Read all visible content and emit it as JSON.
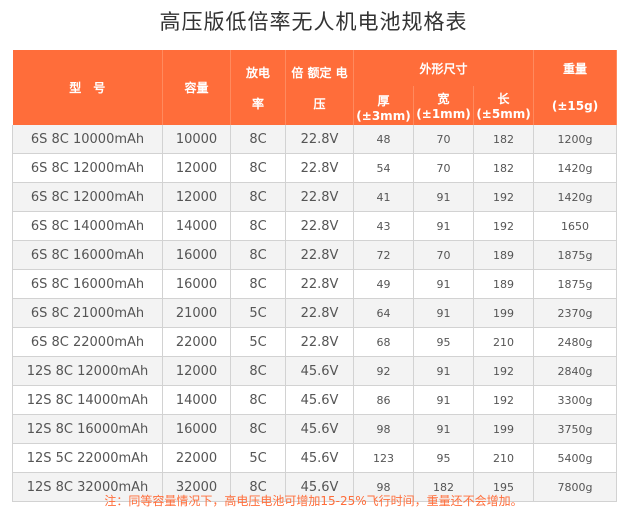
{
  "title": "高压版低倍率无人机电池规格表",
  "header": {
    "model": "型　号",
    "capacity": "容量",
    "rate_top": "放电",
    "rate_bottom": "率",
    "voltage_top": "倍 额定 电",
    "voltage_bottom": "压",
    "dimensions": "外形尺寸",
    "thickness": "厚(±3mm)",
    "width": "宽",
    "width_tol": "(±1mm)",
    "length": "长",
    "length_tol": "(±5mm)",
    "weight": "重量",
    "weight_tol": "(±15g)"
  },
  "rows": [
    [
      "6S 8C 10000mAh",
      "10000",
      "8C",
      "22.8V",
      "48",
      "70",
      "182",
      "1200g"
    ],
    [
      "6S 8C 12000mAh",
      "12000",
      "8C",
      "22.8V",
      "54",
      "70",
      "182",
      "1420g"
    ],
    [
      "6S 8C 12000mAh",
      "12000",
      "8C",
      "22.8V",
      "41",
      "91",
      "192",
      "1420g"
    ],
    [
      "6S 8C 14000mAh",
      "14000",
      "8C",
      "22.8V",
      "43",
      "91",
      "192",
      "1650"
    ],
    [
      "6S 8C 16000mAh",
      "16000",
      "8C",
      "22.8V",
      "72",
      "70",
      "189",
      "1875g"
    ],
    [
      "6S 8C 16000mAh",
      "16000",
      "8C",
      "22.8V",
      "49",
      "91",
      "189",
      "1875g"
    ],
    [
      "6S 8C 21000mAh",
      "21000",
      "5C",
      "22.8V",
      "64",
      "91",
      "199",
      "2370g"
    ],
    [
      "6S 8C 22000mAh",
      "22000",
      "5C",
      "22.8V",
      "68",
      "95",
      "210",
      "2480g"
    ],
    [
      "12S 8C 12000mAh",
      "12000",
      "8C",
      "45.6V",
      "92",
      "91",
      "192",
      "2840g"
    ],
    [
      "12S 8C 14000mAh",
      "14000",
      "8C",
      "45.6V",
      "86",
      "91",
      "192",
      "3300g"
    ],
    [
      "12S 8C 16000mAh",
      "16000",
      "8C",
      "45.6V",
      "98",
      "91",
      "199",
      "3750g"
    ],
    [
      "12S 5C 22000mAh",
      "22000",
      "5C",
      "45.6V",
      "123",
      "95",
      "210",
      "5400g"
    ],
    [
      "12S 8C 32000mAh",
      "32000",
      "8C",
      "45.6V",
      "98",
      "182",
      "195",
      "7800g"
    ]
  ],
  "note": "注：同等容量情况下，高电压电池可增加15-25%飞行时间，重量还不会增加。",
  "colors": {
    "header_bg": "#ff6d3a",
    "note_text": "#ff6d3a"
  }
}
